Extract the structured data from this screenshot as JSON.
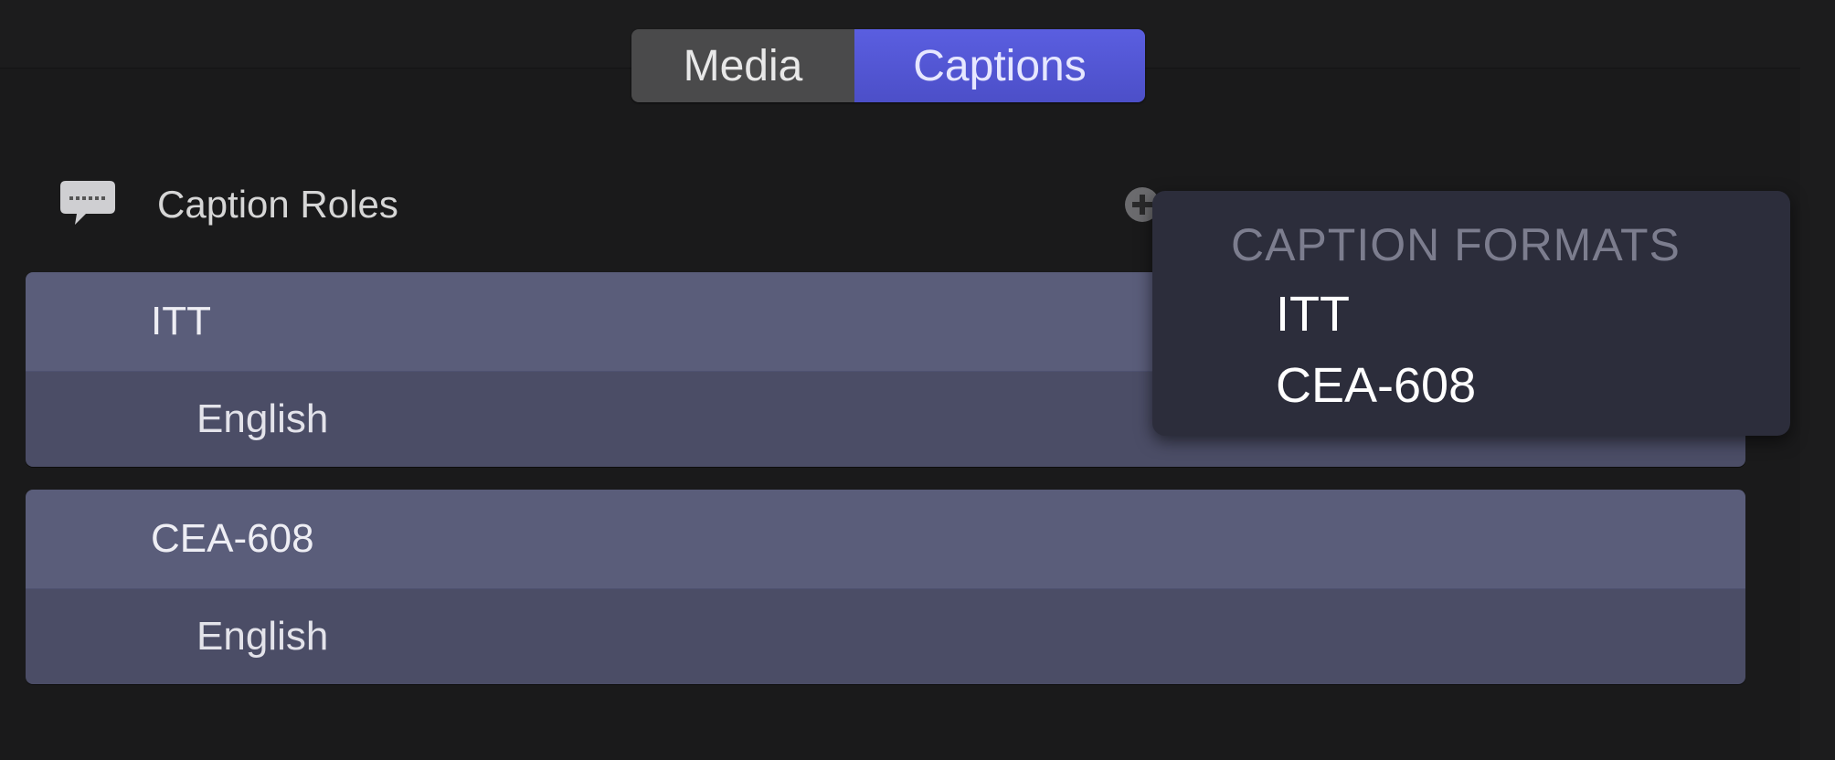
{
  "segmented": {
    "media_label": "Media",
    "captions_label": "Captions",
    "selected": "Captions"
  },
  "roles_header": {
    "title": "Caption Roles",
    "icon": "speech-bubble-icon",
    "add_icon": "add-icon"
  },
  "roles": [
    {
      "name": "ITT",
      "subroles": [
        "English"
      ]
    },
    {
      "name": "CEA-608",
      "subroles": [
        "English"
      ]
    }
  ],
  "popover": {
    "title": "CAPTION FORMATS",
    "items": [
      "ITT",
      "CEA-608"
    ]
  },
  "colors": {
    "accent": "#5a5ee0",
    "role_row": "#5a5d7a",
    "subrole_row": "#4b4d66",
    "background": "#1c1c1d",
    "popover": "#2c2d3b"
  }
}
